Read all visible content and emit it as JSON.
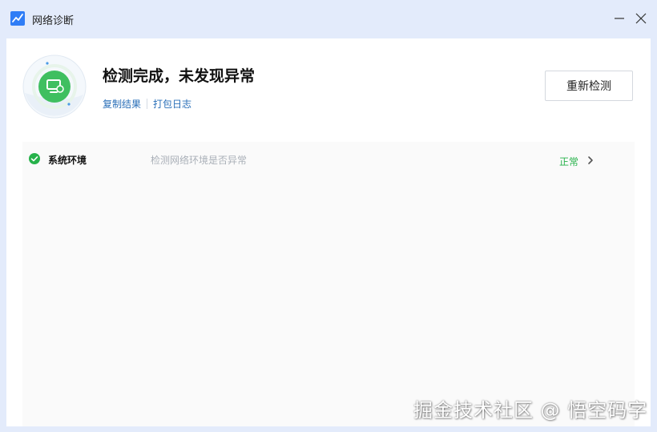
{
  "window": {
    "title": "网络诊断",
    "app_icon": "chart-line-icon",
    "controls": {
      "minimize": "minimize-icon",
      "close": "close-icon"
    }
  },
  "summary": {
    "headline": "检测完成，未发现异常",
    "status_icon": "monitor-check-icon",
    "links": [
      "复制结果",
      "打包日志"
    ],
    "recheck_label": "重新检测"
  },
  "results": [
    {
      "name": "系统环境",
      "description": "检测网络环境是否异常",
      "status": "正常",
      "status_icon": "check-circle-icon"
    }
  ],
  "colors": {
    "accent_green": "#27b24b",
    "link_blue": "#2a6fb8",
    "window_bg": "#e3ebfb"
  },
  "watermark": "掘金技术社区 @ 悟空码字"
}
